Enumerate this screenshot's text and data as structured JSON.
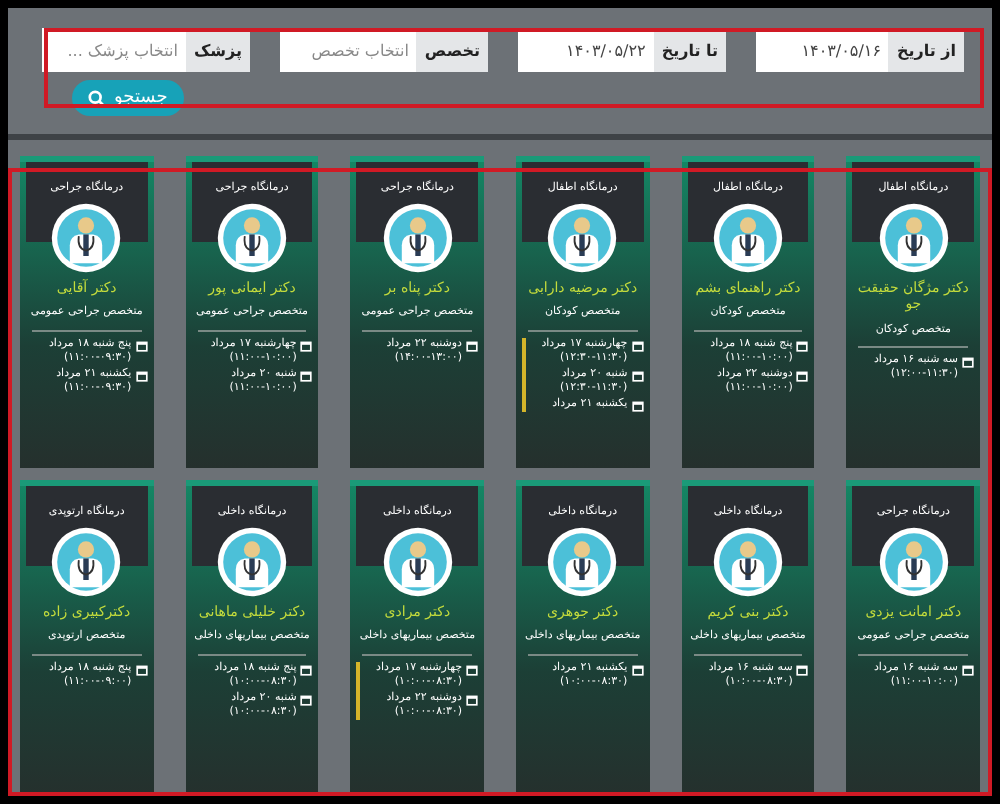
{
  "filters": [
    {
      "label": "از تاریخ",
      "value": "۱۴۰۳/۰۵/۱۶"
    },
    {
      "label": "تا تاریخ",
      "value": "۱۴۰۳/۰۵/۲۲"
    },
    {
      "label": "تخصص",
      "placeholder": "انتخاب تخصص"
    },
    {
      "label": "پزشک",
      "placeholder": "انتخاب پزشک ..."
    }
  ],
  "search_button": "جستجو",
  "doctors": [
    {
      "clinic": "درمانگاه اطفال",
      "name": "دکتر مژگان حقیقت جو",
      "specialty": "متخصص کودکان",
      "scrollable": false,
      "schedule": [
        "سه شنبه ۱۶ مرداد (۱۱:۳۰-۱۲:۰۰)"
      ]
    },
    {
      "clinic": "درمانگاه اطفال",
      "name": "دکتر راهنمای بشم",
      "specialty": "متخصص کودکان",
      "scrollable": false,
      "schedule": [
        "پنج شنبه ۱۸ مرداد (۱۰:۰۰-۱۱:۰۰)",
        "دوشنبه ۲۲ مرداد (۱۰:۰۰-۱۱:۰۰)"
      ]
    },
    {
      "clinic": "درمانگاه اطفال",
      "name": "دکتر مرضیه دارابی",
      "specialty": "متخصص کودکان",
      "scrollable": true,
      "schedule": [
        "چهارشنبه ۱۷ مرداد (۱۱:۳۰-۱۲:۳۰)",
        "شنبه ۲۰ مرداد (۱۱:۳۰-۱۲:۳۰)",
        "یکشنبه ۲۱ مرداد"
      ]
    },
    {
      "clinic": "درمانگاه جراحی",
      "name": "دکتر پناه بر",
      "specialty": "متخصص جراحی عمومی",
      "scrollable": false,
      "schedule": [
        "دوشنبه ۲۲ مرداد (۱۳:۰۰-۱۴:۰۰)"
      ]
    },
    {
      "clinic": "درمانگاه جراحی",
      "name": "دکتر ایمانی پور",
      "specialty": "متخصص جراحی عمومی",
      "scrollable": false,
      "schedule": [
        "چهارشنبه ۱۷ مرداد (۱۰:۰۰-۱۱:۰۰)",
        "شنبه ۲۰ مرداد (۱۰:۰۰-۱۱:۰۰)"
      ]
    },
    {
      "clinic": "درمانگاه جراحی",
      "name": "دکتر آقایی",
      "specialty": "متخصص جراحی عمومی",
      "scrollable": false,
      "schedule": [
        "پنج شنبه ۱۸ مرداد (۰۹:۳۰-۱۱:۰۰)",
        "یکشنبه ۲۱ مرداد (۰۹:۳۰-۱۱:۰۰)"
      ]
    },
    {
      "clinic": "درمانگاه جراحی",
      "name": "دکتر امانت یزدی",
      "specialty": "متخصص جراحی عمومی",
      "scrollable": false,
      "schedule": [
        "سه شنبه ۱۶ مرداد (۱۰:۰۰-۱۱:۰۰)"
      ]
    },
    {
      "clinic": "درمانگاه داخلی",
      "name": "دکتر بنی کریم",
      "specialty": "متخصص بیماریهای داخلی",
      "scrollable": false,
      "schedule": [
        "سه شنبه ۱۶ مرداد (۰۸:۳۰-۱۰:۰۰)"
      ]
    },
    {
      "clinic": "درمانگاه داخلی",
      "name": "دکتر جوهری",
      "specialty": "متخصص بیماریهای داخلی",
      "scrollable": false,
      "schedule": [
        "یکشنبه ۲۱ مرداد (۰۸:۳۰-۱۰:۰۰)"
      ]
    },
    {
      "clinic": "درمانگاه داخلی",
      "name": "دکتر مرادی",
      "specialty": "متخصص بیماریهای داخلی",
      "scrollable": true,
      "schedule": [
        "چهارشنبه ۱۷ مرداد (۰۸:۳۰-۱۰:۰۰)",
        "دوشنبه ۲۲ مرداد (۰۸:۳۰-۱۰:۰۰)"
      ]
    },
    {
      "clinic": "درمانگاه داخلی",
      "name": "دکتر خلیلی ماهانی",
      "specialty": "متخصص بیماریهای داخلی",
      "scrollable": false,
      "schedule": [
        "پنج شنبه ۱۸ مرداد (۰۸:۳۰-۱۰:۰۰)",
        "شنبه ۲۰ مرداد (۰۸:۳۰-۱۰:۰۰)"
      ]
    },
    {
      "clinic": "درمانگاه ارتوپدی",
      "name": "دکترکبیری زاده",
      "specialty": "متخصص ارتوپدی",
      "scrollable": false,
      "schedule": [
        "پنج شنبه ۱۸ مرداد (۰۹:۰۰-۱۱:۰۰)"
      ]
    }
  ]
}
